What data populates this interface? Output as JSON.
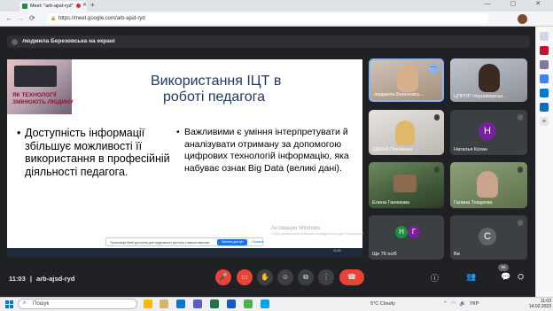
{
  "browser": {
    "tab_title": "Meet: \"arb-ajsd-ryd\"",
    "url": "https://meet.google.com/arb-ajsd-ryd",
    "new_tab_symbol": "+",
    "window_controls": "— ▢ ✕"
  },
  "meet": {
    "presenter_banner": "людмила Березовська на екрані",
    "meeting_code": "arb-ajsd-ryd",
    "participant_count": "85",
    "participants": [
      {
        "name": "людмила Березовсь...",
        "type": "video"
      },
      {
        "name": "ЦПРПП Чорноморськ...",
        "type": "video"
      },
      {
        "name": "ЗДОНЗ Перлинка",
        "type": "video"
      },
      {
        "name": "Наталья Кохан",
        "type": "avatar",
        "initial": "Н",
        "color": "#7b1fa2"
      },
      {
        "name": "Елена Ганюкова",
        "type": "video"
      },
      {
        "name": "Галина Токарева",
        "type": "video"
      },
      {
        "name": "Ще 76 осіб",
        "type": "group",
        "initials": [
          "Н",
          "Г"
        ]
      },
      {
        "name": "Ви",
        "type": "avatar",
        "initial": "С",
        "color": "#5f6368"
      }
    ]
  },
  "slide": {
    "photo_caption": [
      "ЯК ТЕХНОЛОГІЇ",
      "ЗМІНЮЮТЬ ЛЮДИНУ"
    ],
    "title_line1": "Використання ІЦТ в",
    "title_line2": "роботі педагога",
    "bullet_left": "Доступність інформації збільшує можливості її використання в професійній діяльності педагога.",
    "bullet_right": "Важливими є уміння інтерпретувати й аналізувати отриману за допомогою цифрових технологій інформацію, яка набуває ознак Big Data (великі дані).",
    "watermark": "Активация Windows",
    "watermark_sub": "Чтобы активировать Windows, перейдите в раздел \"Параметры\".",
    "notice_text": "Трансляція Meet доступна для подальшого доступу з вашою версією.",
    "notice_button": "Змінити доступ",
    "notice_hide": "Сховати",
    "inner_clock": "11:03"
  },
  "bottom_bar": {
    "time": "11:03",
    "separator": "|",
    "controls": [
      "mic-off",
      "camera-off",
      "captions",
      "raise-hand",
      "emoji",
      "present",
      "more",
      "leave"
    ]
  },
  "taskbar": {
    "search_placeholder": "Пошук",
    "weather": "5°C  Cloudy",
    "language": "УКР",
    "time": "11:03",
    "date": "14.02.2023"
  }
}
